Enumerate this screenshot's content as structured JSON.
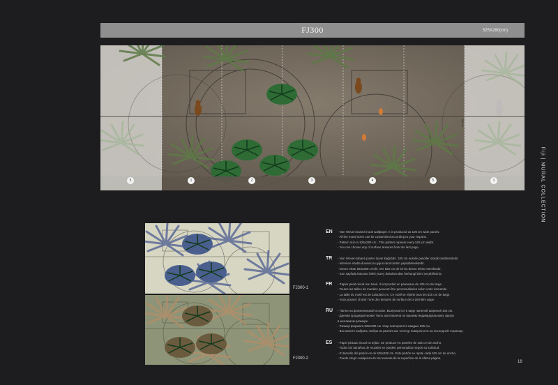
{
  "header": {
    "title": "FJ300",
    "size": "525X280(cm)"
  },
  "mural": {
    "panel_numbers": [
      "5",
      "1",
      "2",
      "3",
      "4",
      "5",
      "1"
    ],
    "dimension": "280cm"
  },
  "side_label": "Fiji | MURAL COLLECTION",
  "variants": [
    {
      "code": "FJ300-1"
    },
    {
      "code": "FJ300-2"
    }
  ],
  "languages": [
    {
      "code": "EN",
      "lines": [
        "- Non Woven based mural wallpaper. It is produced as 105 cm wide panels.",
        "- All the mural sizes can be customised according to  your request.",
        "- Pattern size is 525x280 cm . This pattern repeats every 525 cm width.",
        "- You can choose any of surface textures from  the last page."
      ]
    },
    {
      "code": "TR",
      "lines": [
        "- Non Woven tabanlı poster duvar kağıdıdır. 105 cm eninde panoller olarak üretilmektedir.",
        "- İsteniIen ebatta duvaınıza uygun  rand üretim yapılabilmektedir.",
        "- Desen ebatı 525x280 cm'dir.  Her 525 cm de bir bu desen tekrar etmektedir.",
        "- Son sayfada bulunan farklı yüzey dokularından herhangi birini seçebilirsiniz."
      ]
    },
    {
      "code": "FR",
      "lines": [
        "- Papier peint mural non tissé. Il est produit en panneaux de 105 cm de large.",
        "- Toutes les tailles de murales peuvent être personnalisées  selon votre demande.",
        "- La taille du motif est de 525x280 cm.  Ce motif se répète tous les 525 cm de large.",
        "- Vous pouvez choisir l'une des textures de surface de la dernière page."
      ]
    },
    {
      "code": "RU",
      "lines": [
        "- Панно на флизелиновой основе. Выпускается в виде панелей шириной 105 см.",
        "- Данная продукция может быть изготовлена по вашему индивидуальному заказу",
        "  в желаемом размере.",
        "- Размер формата 525x280 см. Узор повторяется каждые 525 см.",
        "- Вы можете выбрать любую из различных текстур поверхности на последней странице."
      ]
    },
    {
      "code": "ES",
      "lines": [
        "- Papel pintado mural no tejido. Se produce en paneles de 105 cm de ancho.",
        "- Todos los tamaños de murales se pueden personalizar según su solicitud.",
        "- El tamaño del patrón es de 525x280 cm. Este patrón se repite cada 525 cm de ancho.",
        "- Puede elegir cualquiera de las texturas de la superficie de la última página"
      ]
    }
  ],
  "page_number": "18"
}
